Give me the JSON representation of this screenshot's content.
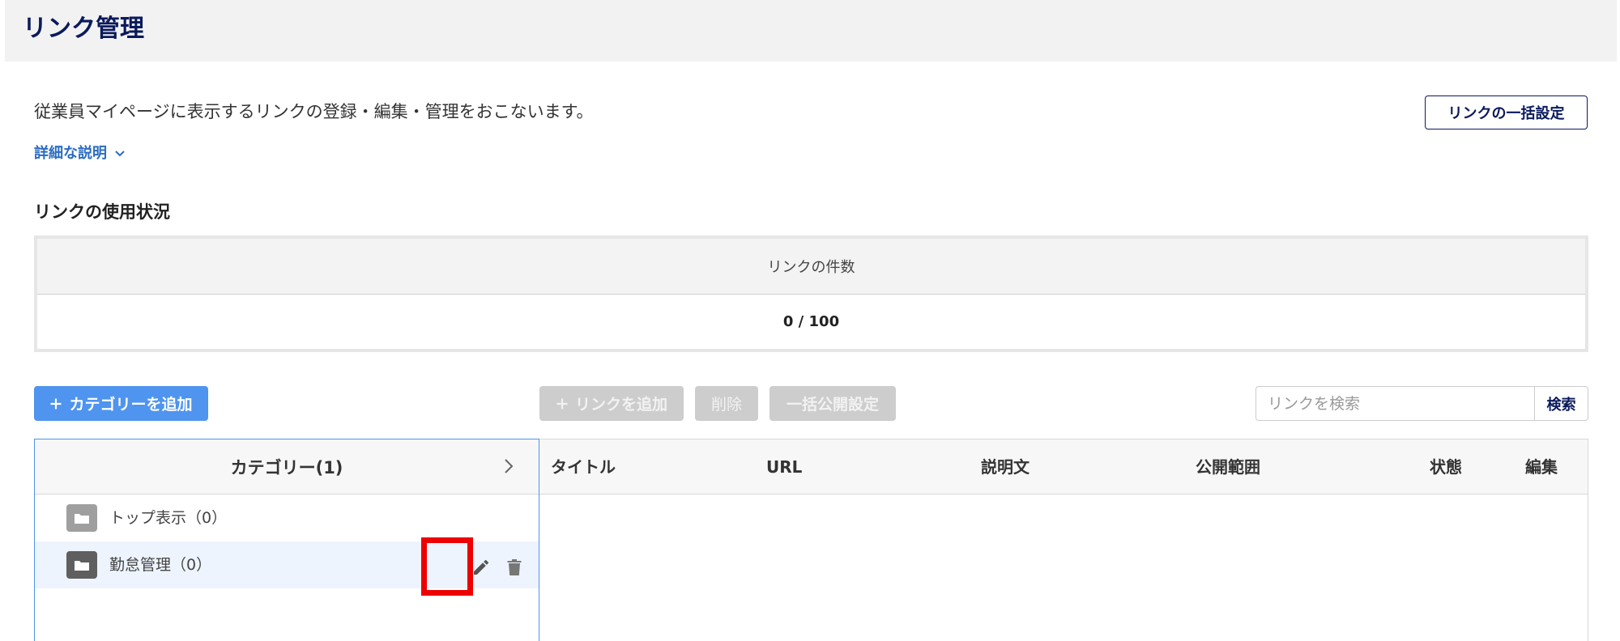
{
  "header": {
    "title": "リンク管理"
  },
  "intro": {
    "description": "従業員マイページに表示するリンクの登録・編集・管理をおこないます。",
    "details_label": "詳細な説明",
    "bulk_settings_label": "リンクの一括設定"
  },
  "usage": {
    "section_title": "リンクの使用状況",
    "column_label": "リンクの件数",
    "value": "0 / 100"
  },
  "toolbar": {
    "add_category_label": "カテゴリーを追加",
    "add_link_label": "リンクを追加",
    "delete_label": "削除",
    "bulk_publish_label": "一括公開設定",
    "search_placeholder": "リンクを検索",
    "search_button_label": "検索"
  },
  "categories": {
    "header_label": "カテゴリー(1)",
    "items": [
      {
        "label": "トップ表示（0）",
        "folder_color": "#9f9f9f"
      },
      {
        "label": "勤怠管理（0）",
        "folder_color": "#5f5f5f",
        "selected": true
      }
    ]
  },
  "link_table": {
    "columns": [
      "タイトル",
      "URL",
      "説明文",
      "公開範囲",
      "状態",
      "編集"
    ],
    "rows": []
  },
  "colors": {
    "brand_navy": "#0a1a5c",
    "accent_blue": "#4f94ee",
    "highlight_red": "#ee0000",
    "disabled_gray": "#cdcdcd"
  }
}
